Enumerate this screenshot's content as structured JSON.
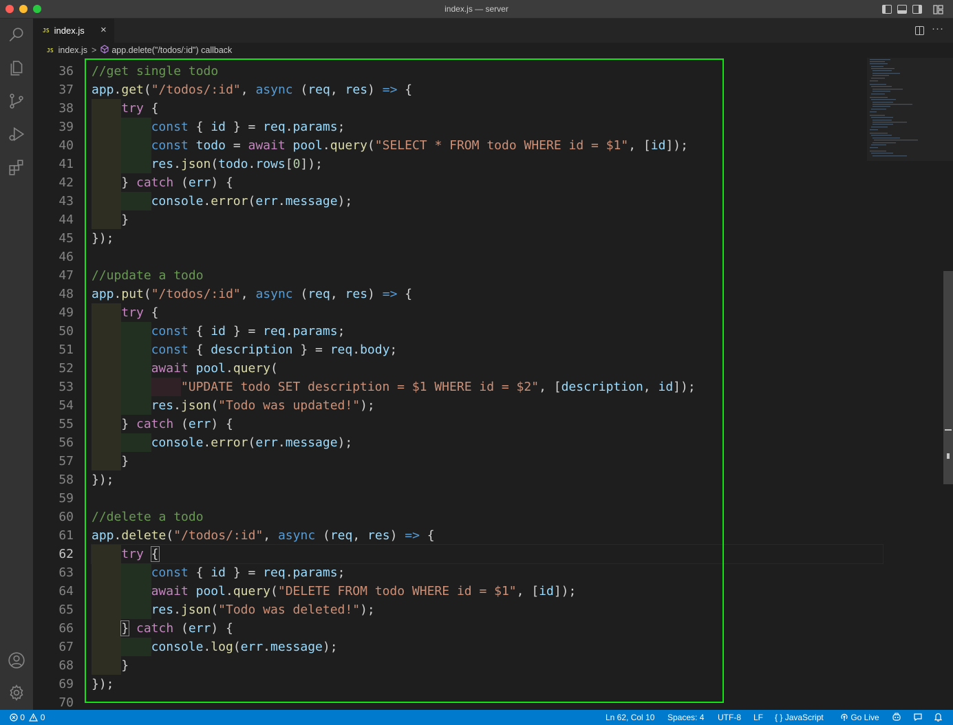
{
  "window": {
    "title": "index.js — server"
  },
  "tab": {
    "badge": "JS",
    "label": "index.js",
    "close": "×"
  },
  "breadcrumb": {
    "file_badge": "JS",
    "file": "index.js",
    "separator": ">",
    "symbol": "app.delete(\"/todos/:id\") callback"
  },
  "editor": {
    "current_line": 62,
    "line_numbers": [
      "36",
      "37",
      "38",
      "39",
      "40",
      "41",
      "42",
      "43",
      "44",
      "45",
      "46",
      "47",
      "48",
      "49",
      "50",
      "51",
      "52",
      "53",
      "54",
      "55",
      "56",
      "57",
      "58",
      "59",
      "60",
      "61",
      "62",
      "63",
      "64",
      "65",
      "66",
      "67",
      "68",
      "69",
      "70"
    ]
  },
  "activitybar": [
    "explorer-icon",
    "search-icon",
    "source-control-icon",
    "run-debug-icon",
    "extensions-icon",
    "accounts-icon",
    "settings-gear-icon"
  ],
  "statusbar": {
    "errors": "0",
    "warnings": "0",
    "position": "Ln 62, Col 10",
    "spaces": "Spaces: 4",
    "encoding": "UTF-8",
    "eol": "LF",
    "language_brace": "{ }",
    "language": "JavaScript",
    "golive": "Go Live"
  },
  "colors": {
    "accent": "#007acc",
    "highlight_box": "#14e314",
    "titlebar": "#3c3c3c",
    "editor_bg": "#1e1e1e"
  }
}
